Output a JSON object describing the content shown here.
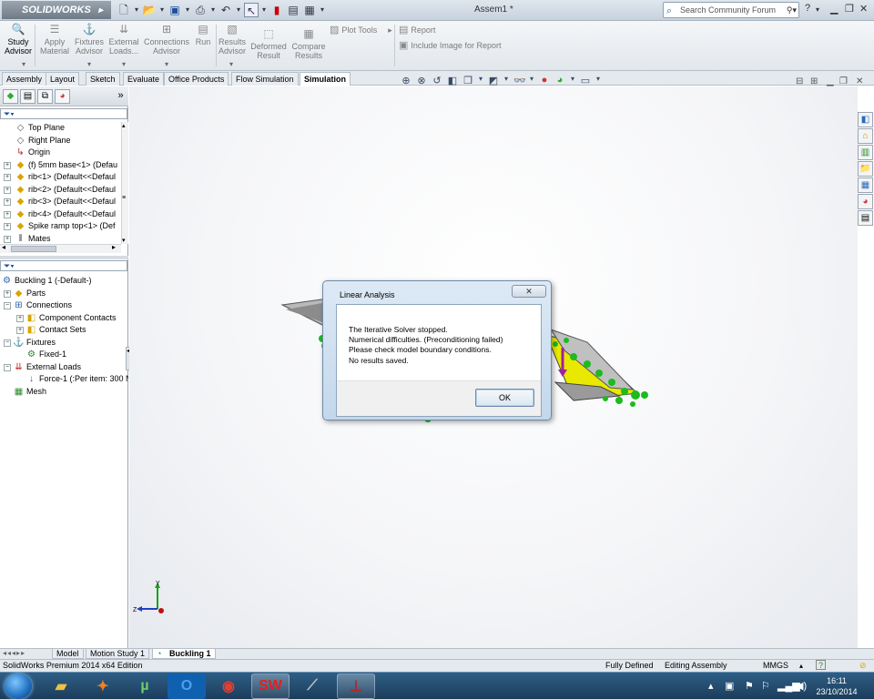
{
  "app": {
    "logo_text": "SOLIDWORKS",
    "document_title": "Assem1 *",
    "search_placeholder": "Search Community Forum"
  },
  "ribbon": {
    "buttons": [
      {
        "label": "Study\nAdvisor",
        "active": true
      },
      {
        "label": "Apply\nMaterial"
      },
      {
        "label": "Fixtures\nAdvisor"
      },
      {
        "label": "External\nLoads..."
      },
      {
        "label": "Connections\nAdvisor"
      },
      {
        "label": "Run"
      },
      {
        "label": "Results\nAdvisor"
      },
      {
        "label": "Deformed\nResult"
      },
      {
        "label": "Compare\nResults"
      }
    ],
    "plot_tools": "Plot Tools",
    "report": "Report",
    "include_image": "Include Image for Report"
  },
  "tabs": [
    "Assembly",
    "Layout",
    "Sketch",
    "Evaluate",
    "Office Products",
    "Flow Simulation",
    "Simulation"
  ],
  "active_tab": "Simulation",
  "feature_tree": [
    {
      "label": "Top Plane",
      "icon": "plane-icon"
    },
    {
      "label": "Right Plane",
      "icon": "plane-icon"
    },
    {
      "label": "Origin",
      "icon": "origin-icon"
    },
    {
      "label": "(f) 5mm base<1> (Defau",
      "icon": "part-icon"
    },
    {
      "label": "rib<1> (Default<<Defaul",
      "icon": "part-icon"
    },
    {
      "label": "rib<2> (Default<<Defaul",
      "icon": "part-icon"
    },
    {
      "label": "rib<3> (Default<<Defaul",
      "icon": "part-icon"
    },
    {
      "label": "rib<4> (Default<<Defaul",
      "icon": "part-icon"
    },
    {
      "label": "Spike ramp top<1> (Def",
      "icon": "part-icon"
    },
    {
      "label": "Mates",
      "icon": "mates-icon"
    }
  ],
  "study_tree": [
    {
      "label": "Buckling 1 (-Default-)",
      "icon": "study-icon"
    },
    {
      "label": "Parts",
      "icon": "parts-icon"
    },
    {
      "label": "Connections",
      "icon": "connections-icon"
    },
    {
      "label": "Component Contacts",
      "icon": "contacts-icon"
    },
    {
      "label": "Contact Sets",
      "icon": "contacts-icon"
    },
    {
      "label": "Fixtures",
      "icon": "fixtures-icon"
    },
    {
      "label": "Fixed-1",
      "icon": "fixed-icon"
    },
    {
      "label": "External Loads",
      "icon": "loads-icon"
    },
    {
      "label": "Force-1 (:Per item: 300 N",
      "icon": "force-icon"
    },
    {
      "label": "Mesh",
      "icon": "mesh-icon"
    }
  ],
  "dialog": {
    "title": "Linear Analysis",
    "close_label": "✕",
    "lines": [
      "The Iterative Solver stopped.",
      "Numerical difficulties. (Preconditioning failed)",
      "Please check model boundary conditions.",
      "No results saved."
    ],
    "ok_label": "OK"
  },
  "bottom_tabs": [
    "Model",
    "Motion Study 1",
    "Buckling 1"
  ],
  "active_bottom_tab": "Buckling 1",
  "status": {
    "edition": "SolidWorks Premium 2014 x64 Edition",
    "defined": "Fully Defined",
    "mode": "Editing Assembly",
    "units": "MMGS"
  },
  "clock": {
    "time": "16:11",
    "date": "23/10/2014"
  },
  "triad": {
    "y": "Y",
    "z": "Z"
  }
}
